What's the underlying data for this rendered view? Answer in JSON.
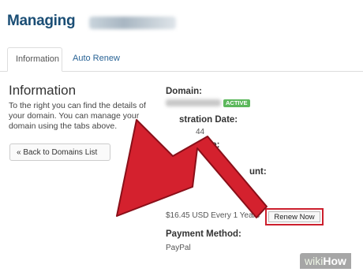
{
  "header": {
    "title": "Managing"
  },
  "tabs": [
    {
      "label": "Information",
      "active": true
    },
    {
      "label": "Auto Renew",
      "active": false
    }
  ],
  "info": {
    "heading": "Information",
    "description": "To the right you can find the details of your domain. You can manage your domain using the tabs above.",
    "back_button": "« Back to Domains List"
  },
  "details": {
    "domain_label": "Domain:",
    "status_badge": "ACTIVE",
    "registration_label": "stration Date:",
    "registration_value": "44",
    "expiry_label": "ate:",
    "amount_label": "unt:",
    "price_value": "$16.45 USD Every 1 Years",
    "renew_button": "Renew Now",
    "payment_label": "Payment Method:",
    "payment_value": "PayPal"
  },
  "colors": {
    "title": "#1b4e75",
    "link": "#2a6496",
    "badge": "#5cb85c",
    "arrow": "#d4212e",
    "highlight_border": "#cc1f2d"
  },
  "watermark": {
    "wiki": "wiki",
    "how": "How"
  }
}
